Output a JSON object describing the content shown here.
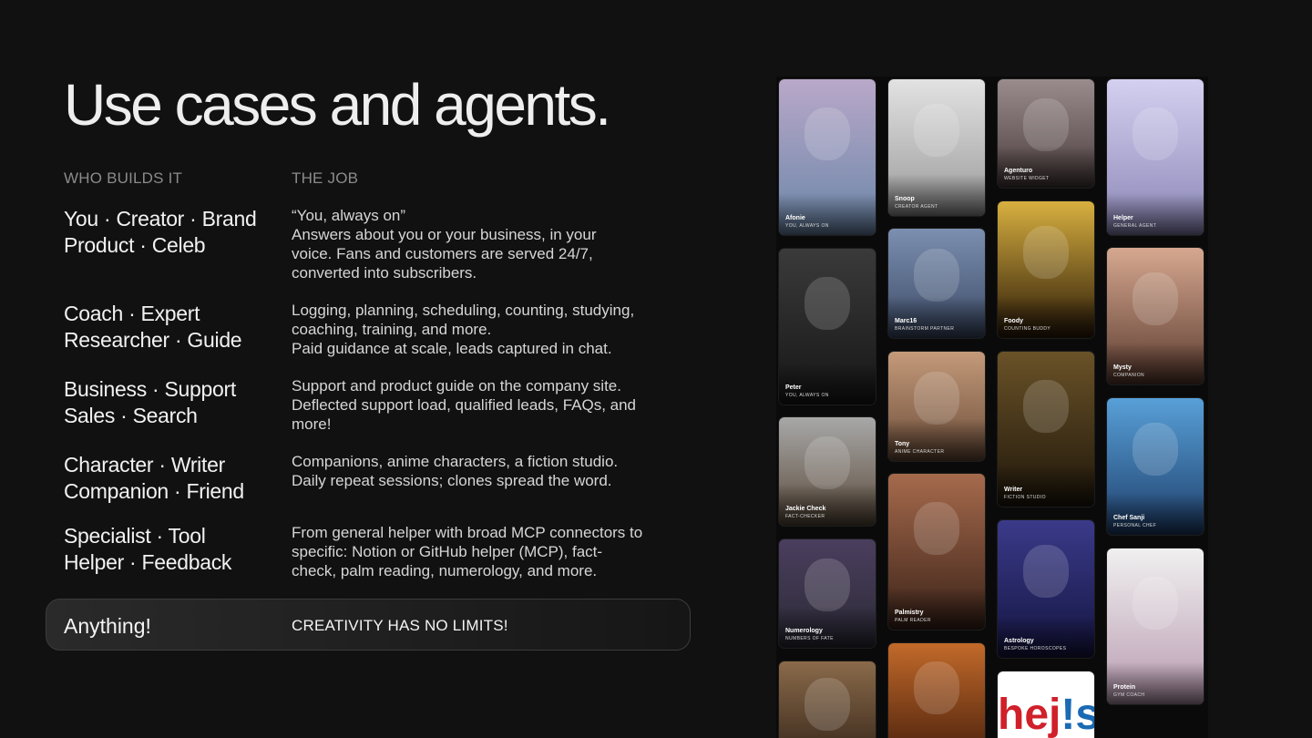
{
  "title": "Use cases and agents.",
  "columns": {
    "who": "WHO BUILDS IT",
    "job": "THE JOB"
  },
  "rows": [
    {
      "who": [
        "You · Creator · Brand",
        "Product · Celeb"
      ],
      "job": [
        "“You, always on”",
        "Answers about you or your business, in your",
        "voice. Fans and customers are served 24/7,",
        "converted into subscribers."
      ]
    },
    {
      "who": [
        "Coach · Expert",
        "Researcher · Guide"
      ],
      "job": [
        "Logging, planning, scheduling, counting, studying,",
        "coaching, training, and more.",
        "Paid guidance at scale, leads captured in chat."
      ]
    },
    {
      "who": [
        "Business · Support",
        "Sales · Search"
      ],
      "job": [
        "Support and product guide on the company site.",
        "Deflected support load, qualified leads, FAQs, and",
        "more!"
      ]
    },
    {
      "who": [
        "Character · Writer",
        "Companion · Friend"
      ],
      "job": [
        "Companions, anime characters, a fiction studio.",
        "Daily repeat sessions; clones spread the word."
      ]
    },
    {
      "who": [
        "Specialist · Tool",
        "Helper · Feedback"
      ],
      "job": [
        "From general helper with broad MCP connectors to",
        "specific: Notion or GitHub helper (MCP), fact-",
        "check, palm reading, numerology, and more."
      ]
    }
  ],
  "anything": {
    "label": "Anything!",
    "tag": "CREATIVITY HAS NO LIMITS!"
  },
  "gallery": {
    "columns": [
      [
        {
          "name": "Afonie",
          "role": "YOU, ALWAYS ON",
          "icon": "pixel-avatar-blond-man",
          "colors": [
            "#b9a8c9",
            "#6a86a8"
          ]
        },
        {
          "name": "Peter",
          "role": "YOU, ALWAYS ON",
          "icon": "photo-man-glasses",
          "colors": [
            "#3a3a3a",
            "#161616"
          ]
        },
        {
          "name": "Jackie Check",
          "role": "FACT-CHECKER",
          "icon": "pixel-avatar-dark-hair",
          "colors": [
            "#a8a8a8",
            "#5a4a3a"
          ]
        },
        {
          "name": "Numerology",
          "role": "NUMBERS OF FATE",
          "icon": "cartoon-woman-curly",
          "colors": [
            "#4a3e5e",
            "#2c2a36"
          ]
        },
        {
          "name": "",
          "role": "",
          "icon": "painting-old-sage",
          "colors": [
            "#8a6a4a",
            "#3e2c1e"
          ]
        }
      ],
      [
        {
          "name": "Snoop",
          "role": "CREATOR AGENT",
          "icon": "photo-man-bucket-hat",
          "colors": [
            "#e2e2e2",
            "#9a9a9a"
          ]
        },
        {
          "name": "Marc16",
          "role": "BRAINSTORM PARTNER",
          "icon": "pixel-avatar-bald-beard",
          "colors": [
            "#7b8fb0",
            "#3c4a66"
          ]
        },
        {
          "name": "Tony",
          "role": "ANIME CHARACTER",
          "icon": "anime-pink-hat-character",
          "colors": [
            "#c49a7a",
            "#6a4c38"
          ]
        },
        {
          "name": "Palmistry",
          "role": "PALM READER",
          "icon": "cartoon-woman-curly-hair",
          "colors": [
            "#a66a4c",
            "#3a2218"
          ]
        },
        {
          "name": "",
          "role": "",
          "icon": "pixel-face-closeup",
          "colors": [
            "#c26a2a",
            "#5a2a10"
          ]
        }
      ],
      [
        {
          "name": "Agenturo",
          "role": "WEBSITE WIDGET",
          "icon": "pixel-avatar-woman",
          "colors": [
            "#9a8c8c",
            "#4a3c3c"
          ]
        },
        {
          "name": "Foody",
          "role": "COUNTING BUDDY",
          "icon": "leopard-pattern",
          "colors": [
            "#d8b040",
            "#2a1a08"
          ]
        },
        {
          "name": "Writer",
          "role": "FICTION STUDIO",
          "icon": "painting-owl-book",
          "colors": [
            "#6a5228",
            "#1e160a"
          ]
        },
        {
          "name": "Astrology",
          "role": "BESPOKE HOROSCOPES",
          "icon": "anime-blue-hair",
          "colors": [
            "#3a3a8a",
            "#141440"
          ]
        },
        {
          "name": "",
          "role": "",
          "icon": "hej-logo",
          "colors": [
            "#ffffff",
            "#ffffff"
          ]
        }
      ],
      [
        {
          "name": "Helper",
          "role": "GENERAL AGENT",
          "icon": "pixel-avatar-spiky-hair",
          "colors": [
            "#d4d0f0",
            "#8a86b6"
          ]
        },
        {
          "name": "Mysty",
          "role": "COMPANION",
          "icon": "photo-woman-portrait",
          "colors": [
            "#d6a890",
            "#5a3a2e"
          ]
        },
        {
          "name": "Chef Sanji",
          "role": "PERSONAL CHEF",
          "icon": "anime-chef-blond",
          "colors": [
            "#58a0d8",
            "#1e3e6a"
          ]
        },
        {
          "name": "Protein",
          "role": "GYM COACH",
          "icon": "cartoon-cat-meditating",
          "colors": [
            "#f0f0f0",
            "#b89ab0"
          ]
        }
      ]
    ],
    "logo_text": [
      "hej",
      "!",
      "s"
    ],
    "colors": {
      "logo_red": "#d0202a",
      "logo_blue": "#1a6ab4"
    }
  }
}
